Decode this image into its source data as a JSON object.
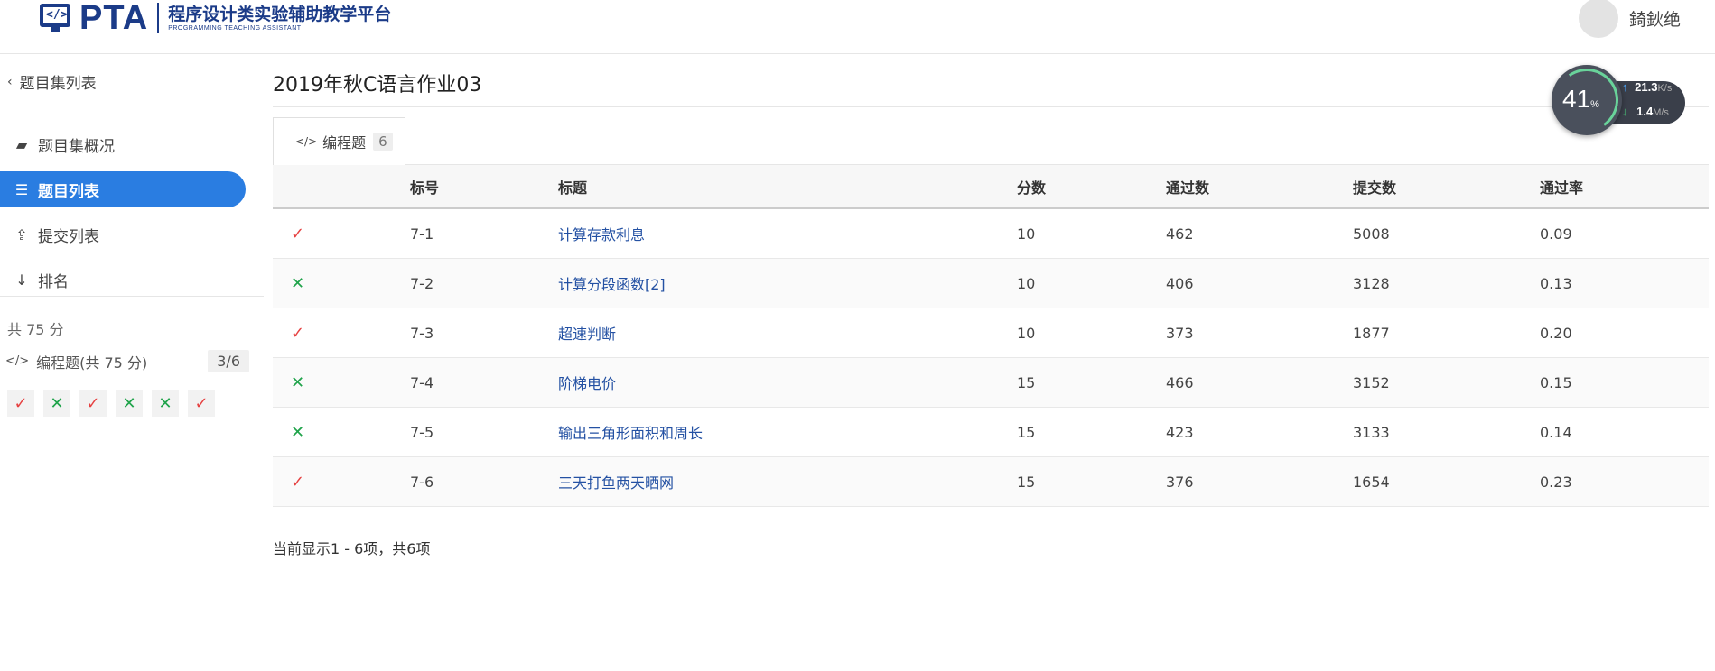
{
  "header": {
    "logo_code_glyph": "</>",
    "logo_text": "PTA",
    "logo_cn": "程序设计类实验辅助教学平台",
    "logo_en": "PROGRAMMING TEACHING ASSISTANT",
    "username": "錡鈥绝"
  },
  "sidebar": {
    "back_label": "题目集列表",
    "nav": [
      {
        "label": "题目集概况",
        "icon": "book-icon"
      },
      {
        "label": "题目列表",
        "icon": "list-icon",
        "active": true
      },
      {
        "label": "提交列表",
        "icon": "upload-icon"
      },
      {
        "label": "排名",
        "icon": "sort-icon"
      }
    ],
    "total": "共 75 分",
    "programming_label": "编程题(共 75 分)",
    "programming_count": "3/6",
    "marks": [
      "✓",
      "✕",
      "✓",
      "✕",
      "✕",
      "✓"
    ]
  },
  "main": {
    "title": "2019年秋C语言作业03",
    "tab_label": "编程题",
    "tab_count": "6",
    "columns": [
      "",
      "标号",
      "标题",
      "分数",
      "通过数",
      "提交数",
      "通过率"
    ],
    "rows": [
      {
        "status": "✓",
        "passed_state": "ok",
        "no": "7-1",
        "title": "计算存款利息",
        "score": "10",
        "passes": "462",
        "submits": "5008",
        "rate": "0.09"
      },
      {
        "status": "✕",
        "passed_state": "no",
        "no": "7-2",
        "title": "计算分段函数[2]",
        "score": "10",
        "passes": "406",
        "submits": "3128",
        "rate": "0.13"
      },
      {
        "status": "✓",
        "passed_state": "ok",
        "no": "7-3",
        "title": "超速判断",
        "score": "10",
        "passes": "373",
        "submits": "1877",
        "rate": "0.20"
      },
      {
        "status": "✕",
        "passed_state": "no",
        "no": "7-4",
        "title": "阶梯电价",
        "score": "15",
        "passes": "466",
        "submits": "3152",
        "rate": "0.15"
      },
      {
        "status": "✕",
        "passed_state": "no",
        "no": "7-5",
        "title": "输出三角形面积和周长",
        "score": "15",
        "passes": "423",
        "submits": "3133",
        "rate": "0.14"
      },
      {
        "status": "✓",
        "passed_state": "ok",
        "no": "7-6",
        "title": "三天打鱼两天晒网",
        "score": "15",
        "passes": "376",
        "submits": "1654",
        "rate": "0.23"
      }
    ],
    "footer": "当前显示1 - 6项，共6项"
  },
  "netmon": {
    "percent": "41",
    "percent_sign": "%",
    "up_value": "21.3",
    "up_unit": "K/s",
    "down_value": "1.4",
    "down_unit": "M/s"
  },
  "colors": {
    "accent": "#2a7de1",
    "brand": "#1b3b88",
    "pass": "#e64242",
    "fail": "#1fa34a",
    "link": "#2451a3"
  }
}
